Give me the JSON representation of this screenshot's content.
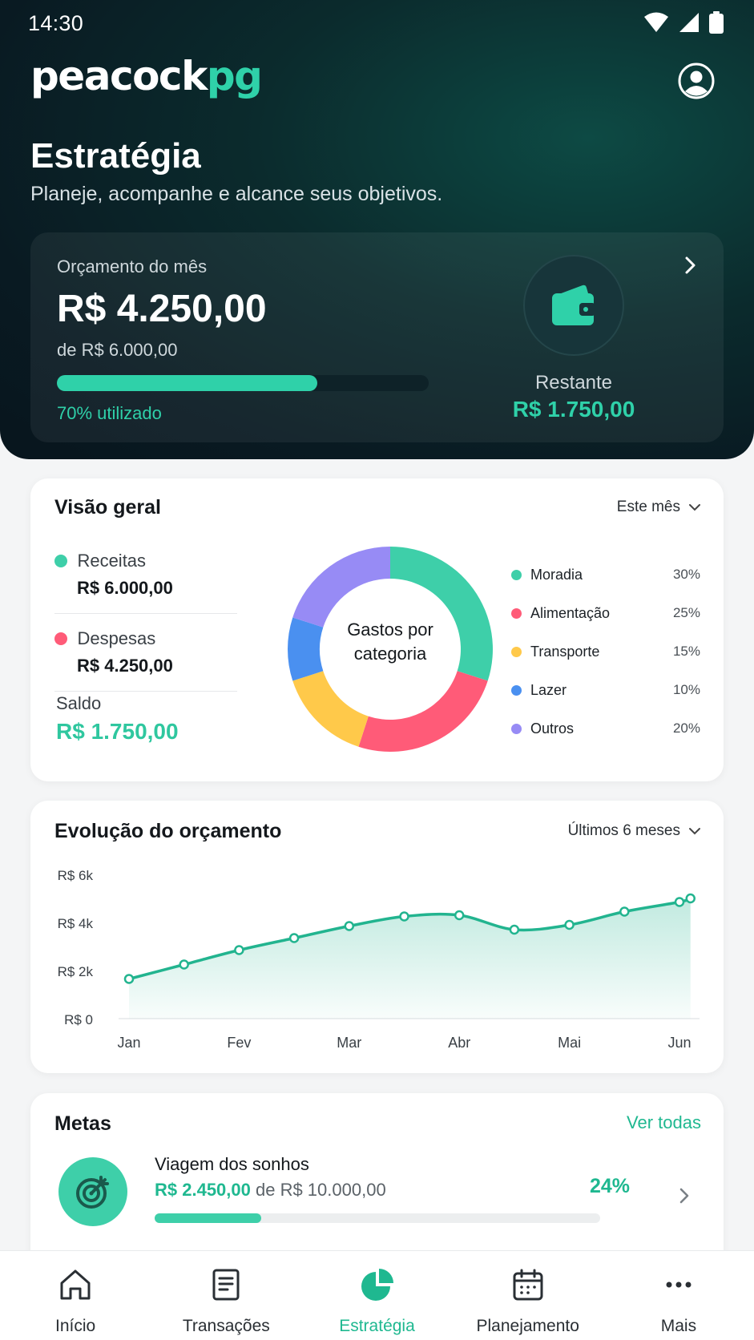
{
  "status": {
    "time": "14:30"
  },
  "brand": {
    "part1": "peacock",
    "part2": "pg"
  },
  "header": {
    "title": "Estratégia",
    "subtitle": "Planeje, acompanhe e alcance seus objetivos."
  },
  "budget": {
    "label": "Orçamento do mês",
    "amount": "R$ 4.250,00",
    "of_total": "de R$ 6.000,00",
    "used_fraction": 0.7,
    "used_label": "70% utilizado",
    "remaining_label": "Restante",
    "remaining_value": "R$ 1.750,00",
    "icon": "wallet-icon"
  },
  "overview": {
    "title": "Visão geral",
    "period": "Este mês",
    "income_label": "Receitas",
    "income_value": "R$ 6.000,00",
    "expense_label": "Despesas",
    "expense_value": "R$ 4.250,00",
    "balance_label": "Saldo",
    "balance_value": "R$ 1.750,00",
    "donut_center": [
      "Gastos por",
      "categoria"
    ],
    "categories": [
      {
        "label": "Moradia",
        "pct": "30%",
        "value": 30,
        "color": "#3ecfa9"
      },
      {
        "label": "Alimentação",
        "pct": "25%",
        "value": 25,
        "color": "#ff5b78"
      },
      {
        "label": "Transporte",
        "pct": "15%",
        "value": 15,
        "color": "#ffc94a"
      },
      {
        "label": "Lazer",
        "pct": "10%",
        "value": 10,
        "color": "#4a90f0"
      },
      {
        "label": "Outros",
        "pct": "20%",
        "value": 20,
        "color": "#978bf5"
      }
    ]
  },
  "evolution": {
    "title": "Evolução do orçamento",
    "period": "Últimos 6 meses"
  },
  "chart_data": {
    "type": "area",
    "categories": [
      "Jan",
      "Fev",
      "Mar",
      "Abr",
      "Mai",
      "Jun"
    ],
    "x": [
      0,
      0.5,
      1,
      1.5,
      2,
      2.5,
      3,
      3.5,
      4,
      4.5,
      5,
      5.1
    ],
    "y": [
      1650,
      2250,
      2850,
      3350,
      3850,
      4250,
      4300,
      3700,
      3900,
      4450,
      4850,
      5000
    ],
    "yticks": [
      "R$ 0",
      "R$ 2k",
      "R$ 4k",
      "R$ 6k"
    ],
    "ylim": [
      0,
      6000
    ],
    "color": "#22b48f"
  },
  "goals": {
    "title": "Metas",
    "see_all": "Ver todas",
    "items": [
      {
        "name": "Viagem dos sonhos",
        "current": "R$ 2.450,00",
        "of_text": " de R$ 10.000,00",
        "pct_label": "24%",
        "fraction": 0.24,
        "icon": "target-icon"
      }
    ]
  },
  "nav": [
    {
      "label": "Início",
      "icon": "home-icon"
    },
    {
      "label": "Transações",
      "icon": "receipt-icon"
    },
    {
      "label": "Estratégia",
      "icon": "pie-chart-icon",
      "active": true
    },
    {
      "label": "Planejamento",
      "icon": "calendar-icon"
    },
    {
      "label": "Mais",
      "icon": "more-icon"
    }
  ]
}
